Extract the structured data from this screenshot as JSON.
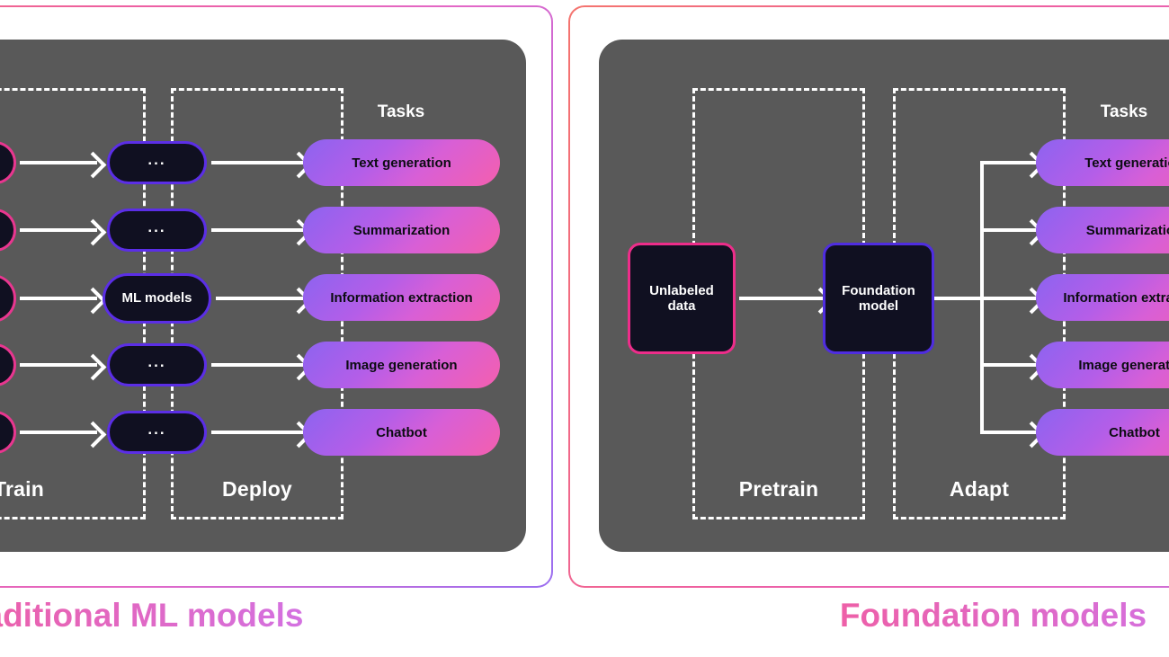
{
  "panels": [
    {
      "id": "traditional",
      "caption": "Traditional ML models",
      "tasks_heading": "Tasks",
      "stages": [
        {
          "key": "train",
          "label": "Train"
        },
        {
          "key": "deploy",
          "label": "Deploy"
        }
      ],
      "model_nodes": [
        {
          "label": "...",
          "placeholder": true
        },
        {
          "label": "...",
          "placeholder": true
        },
        {
          "label": "ML models",
          "placeholder": false
        },
        {
          "label": "...",
          "placeholder": true
        },
        {
          "label": "...",
          "placeholder": true
        }
      ],
      "tasks": [
        "Text generation",
        "Summarization",
        "Information extraction",
        "Image generation",
        "Chatbot"
      ]
    },
    {
      "id": "foundation",
      "caption": "Foundation models",
      "tasks_heading": "Tasks",
      "stages": [
        {
          "key": "pretrain",
          "label": "Pretrain"
        },
        {
          "key": "adapt",
          "label": "Adapt"
        }
      ],
      "nodes": [
        {
          "key": "unlabeled",
          "label": "Unlabeled\ndata",
          "line1": "Unlabeled",
          "line2": "data"
        },
        {
          "key": "foundation",
          "label": "Foundation\nmodel",
          "line1": "Foundation",
          "line2": "model"
        }
      ],
      "tasks": [
        "Text generation",
        "Summarization",
        "Information extraction",
        "Image generation",
        "Chatbot"
      ]
    }
  ],
  "colors": {
    "panel_background": "#595959",
    "page_background": "#ffffff",
    "node_fill": "#101021",
    "node_border_blue": "#5b2ee6",
    "node_border_pink": "#e8368f",
    "task_gradient_start": "#8d63f0",
    "task_gradient_end": "#f45fae",
    "caption_gradient_start": "#f2669e",
    "caption_gradient_end": "#b07ef2",
    "connector": "#ffffff"
  }
}
